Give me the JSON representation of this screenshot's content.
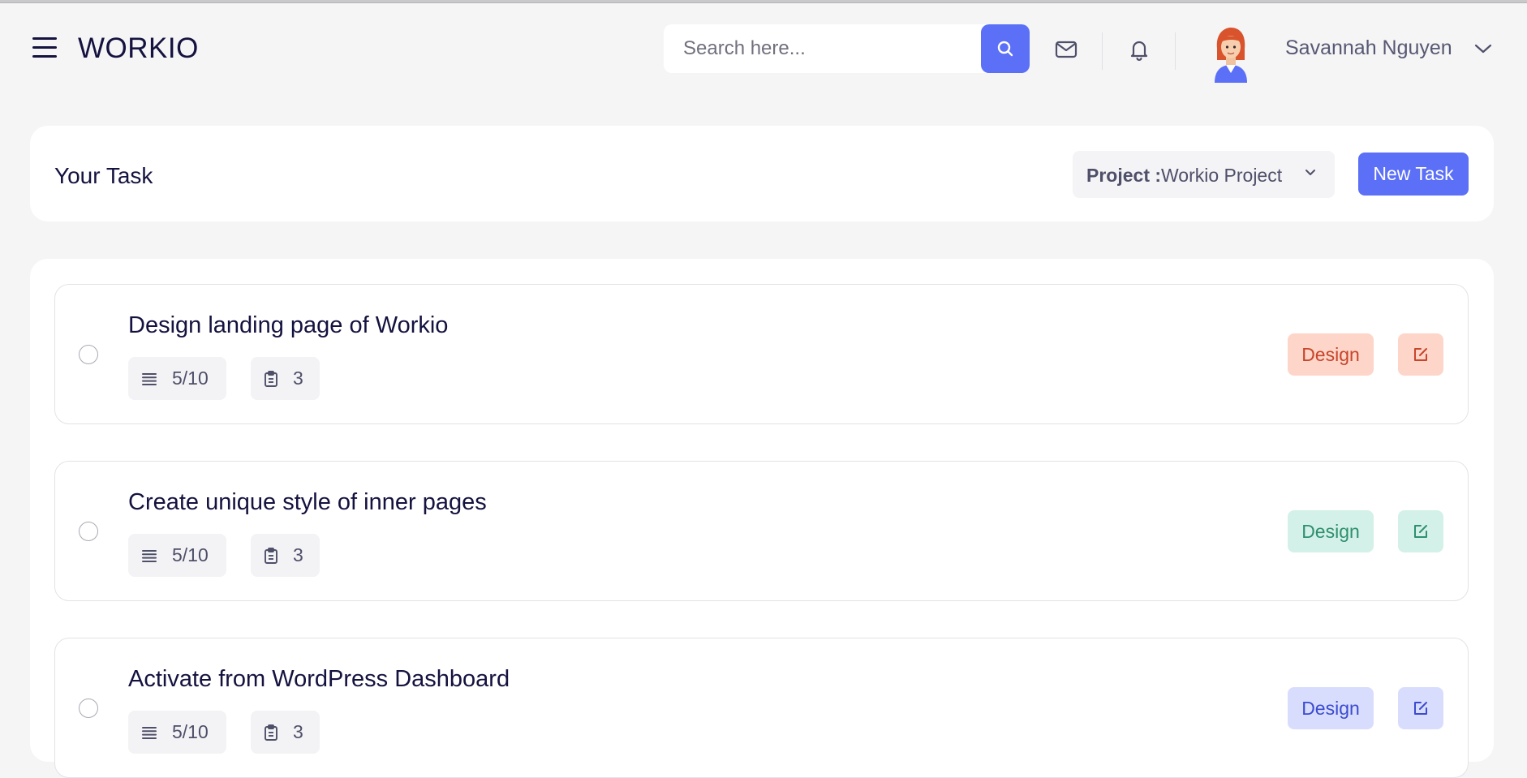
{
  "header": {
    "logo": "WORKIO",
    "search": {
      "placeholder": "Search here..."
    },
    "user": {
      "name": "Savannah Nguyen"
    }
  },
  "task_header": {
    "title": "Your Task",
    "project_label": "Project :",
    "project_value": "Workio Project",
    "new_task_label": "New Task"
  },
  "tasks": [
    {
      "title": "Design landing page of Workio",
      "progress": "5/10",
      "files": "3",
      "tag": "Design",
      "tag_color": "#fdd5c9",
      "tag_text_color": "#c8442a"
    },
    {
      "title": "Create unique style of inner pages",
      "progress": "5/10",
      "files": "3",
      "tag": "Design",
      "tag_color": "#d3f1e8",
      "tag_text_color": "#2f8f6e"
    },
    {
      "title": "Activate from WordPress Dashboard",
      "progress": "5/10",
      "files": "3",
      "tag": "Design",
      "tag_color": "#d9ddfd",
      "tag_text_color": "#3b4bd0"
    }
  ],
  "colors": {
    "accent": "#5b6ff7",
    "background": "#f5f5f6",
    "text": "#14123f"
  },
  "icons": [
    "menu-icon",
    "search-icon",
    "mail-icon",
    "bell-icon",
    "chevron-down-icon",
    "list-icon",
    "clipboard-icon",
    "edit-icon"
  ]
}
